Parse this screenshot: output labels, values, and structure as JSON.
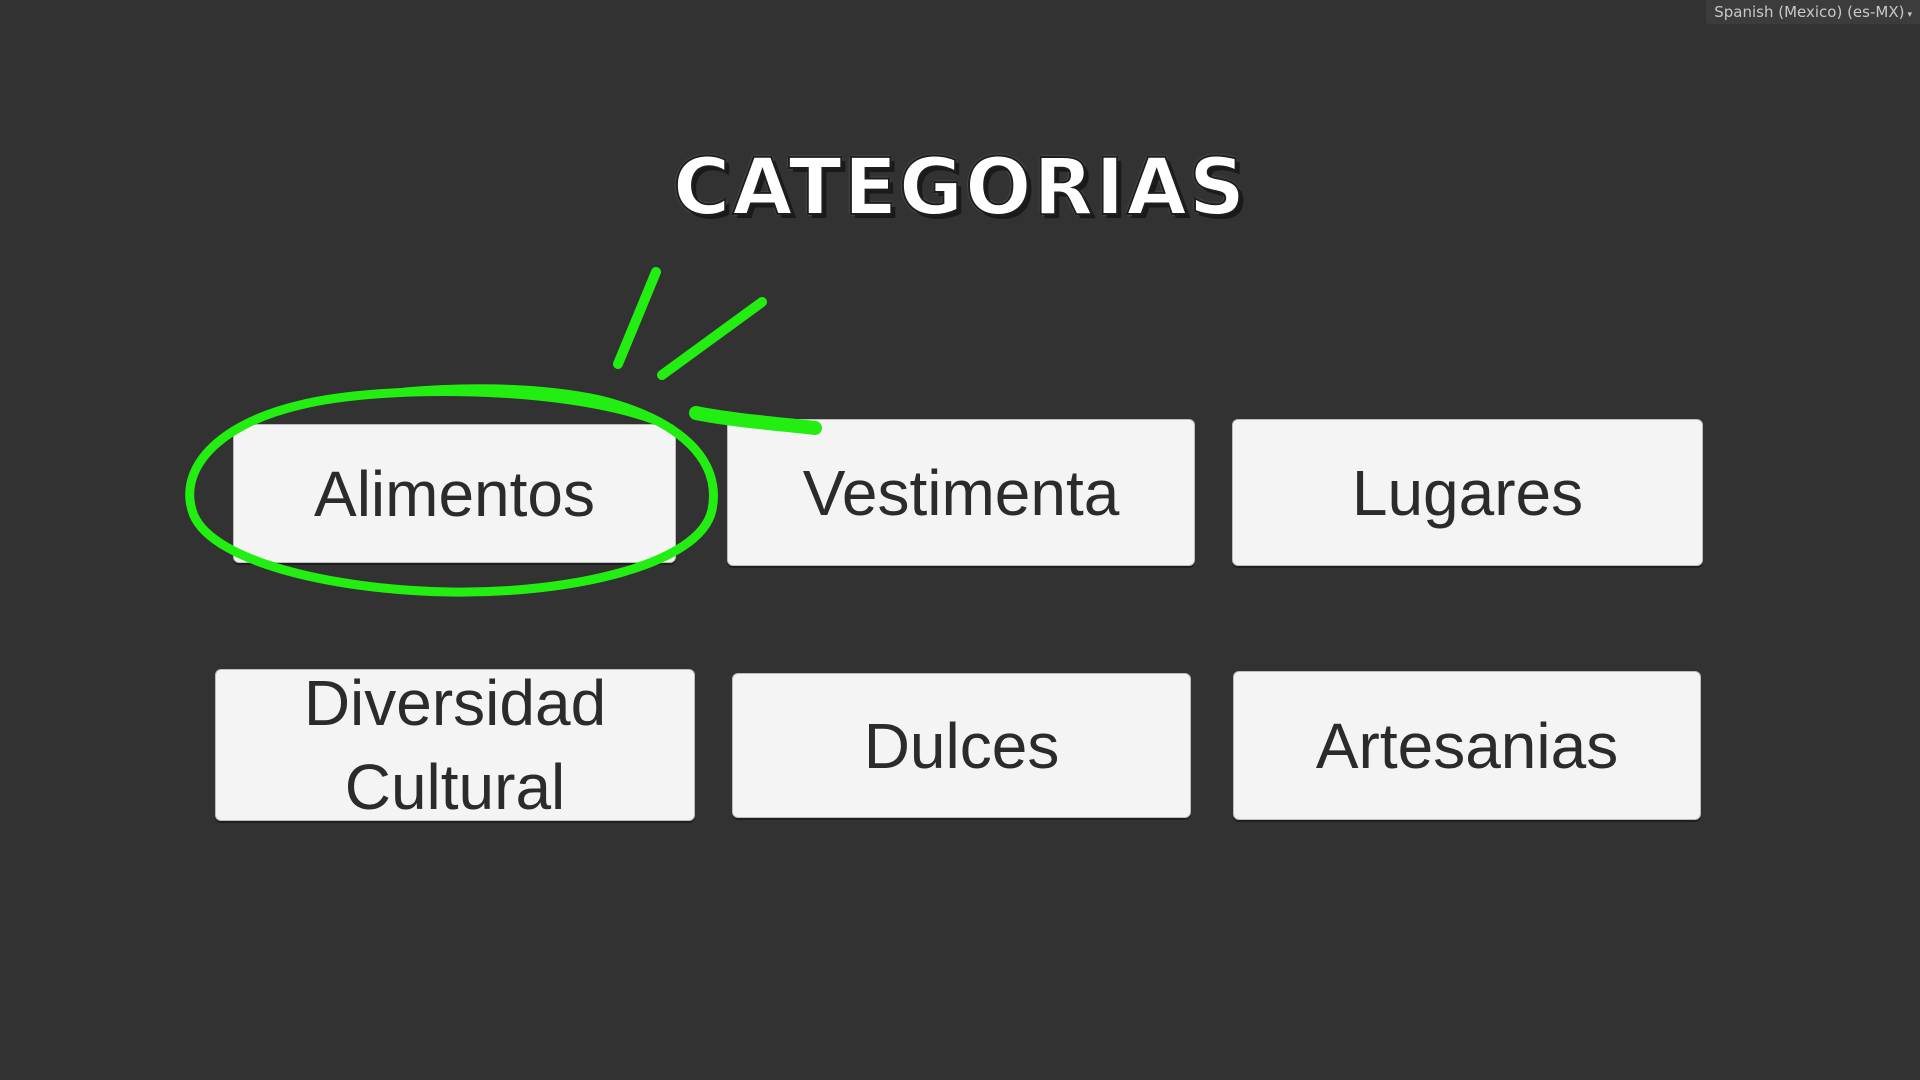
{
  "locale_selector": {
    "label": "Spanish (Mexico) (es-MX)",
    "caret": "▾"
  },
  "title": "CATEGORIAS",
  "categories": [
    {
      "label": "Alimentos"
    },
    {
      "label": "Vestimenta"
    },
    {
      "label": "Lugares"
    },
    {
      "label": "Diversidad Cultural"
    },
    {
      "label": "Dulces"
    },
    {
      "label": "Artesanias"
    }
  ],
  "annotation": {
    "shape": "hand-drawn-circle-with-emphasis-strokes",
    "target": "Alimentos",
    "color": "#22ee11"
  },
  "colors": {
    "background": "#323232",
    "button": "#f4f4f4",
    "button_text": "#2b2b2b",
    "title": "#ffffff"
  }
}
